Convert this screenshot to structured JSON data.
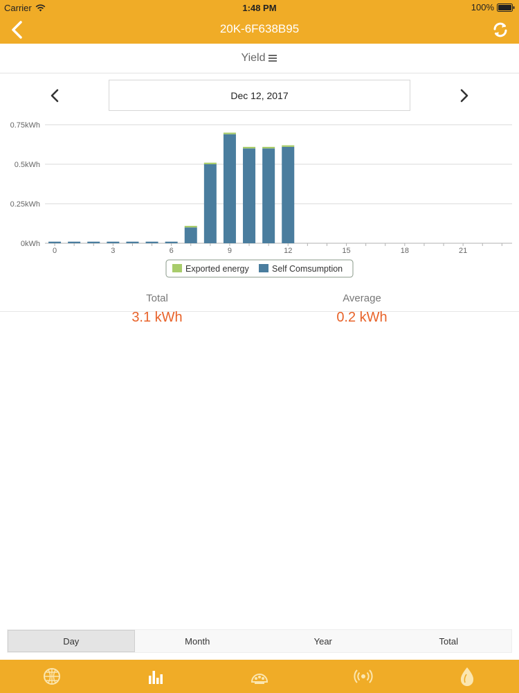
{
  "status": {
    "carrier": "Carrier",
    "time": "1:48 PM",
    "battery": "100%"
  },
  "nav": {
    "title": "20K-6F638B95",
    "back_icon": "chevron-left-icon",
    "refresh_icon": "refresh-icon"
  },
  "selector": {
    "label": "Yield",
    "menu_icon": "hamburger-menu-icon"
  },
  "datebar": {
    "date": "Dec 12, 2017"
  },
  "chart_data": {
    "type": "bar",
    "stacked": true,
    "x": [
      0,
      1,
      2,
      3,
      4,
      5,
      6,
      7,
      8,
      9,
      10,
      11,
      12,
      13,
      14,
      15,
      16,
      17,
      18,
      19,
      20,
      21,
      22,
      23
    ],
    "x_tick_labels": [
      "0",
      "3",
      "6",
      "9",
      "12",
      "15",
      "18",
      "21"
    ],
    "y_tick_labels": [
      "0kWh",
      "0.25kWh",
      "0.5kWh",
      "0.75kWh"
    ],
    "ylim": [
      0,
      0.75
    ],
    "grid": true,
    "legend_position": "bottom",
    "series": [
      {
        "name": "Self Comsumption",
        "color": "#4a7d9e",
        "values": [
          0.01,
          0.01,
          0.01,
          0.01,
          0.01,
          0.01,
          0.01,
          0.1,
          0.5,
          0.69,
          0.6,
          0.6,
          0.61,
          0,
          0,
          0,
          0,
          0,
          0,
          0,
          0,
          0,
          0,
          0
        ]
      },
      {
        "name": "Exported energy",
        "color": "#a8cc6b",
        "values": [
          0,
          0,
          0,
          0,
          0,
          0,
          0,
          0.01,
          0.01,
          0.01,
          0.01,
          0.01,
          0.01,
          0,
          0,
          0,
          0,
          0,
          0,
          0,
          0,
          0,
          0,
          0
        ]
      }
    ]
  },
  "stats": {
    "total_label": "Total",
    "total_value": "3.1 kWh",
    "average_label": "Average",
    "average_value": "0.2 kWh"
  },
  "segments": [
    {
      "label": "Day",
      "active": true
    },
    {
      "label": "Month",
      "active": false
    },
    {
      "label": "Year",
      "active": false
    },
    {
      "label": "Total",
      "active": false
    }
  ],
  "tabs": [
    {
      "icon": "globe-grid-icon"
    },
    {
      "icon": "bar-chart-icon"
    },
    {
      "icon": "inverter-icon"
    },
    {
      "icon": "signal-broadcast-icon"
    },
    {
      "icon": "leaf-drop-icon"
    }
  ]
}
